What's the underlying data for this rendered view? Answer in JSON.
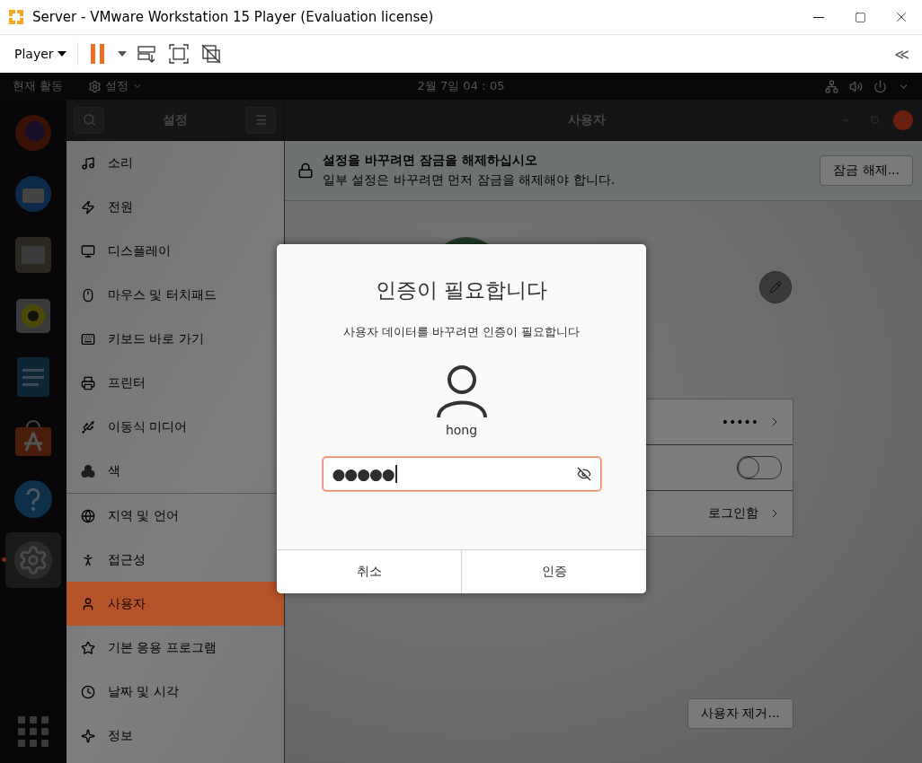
{
  "window": {
    "title": "Server - VMware Workstation 15 Player (Evaluation license)"
  },
  "toolbar": {
    "player_menu": "Player",
    "collapse": "≪"
  },
  "top_bar": {
    "activities": "현재 활동",
    "app_menu": "설정",
    "clock": "2월 7일  04：05"
  },
  "dock_items": [
    {
      "running": false
    },
    {
      "running": false
    },
    {
      "running": false
    },
    {
      "running": false
    },
    {
      "running": false
    },
    {
      "running": false
    },
    {
      "running": false
    },
    {
      "running": true
    }
  ],
  "settings_header": {
    "sidebar_title": "설정",
    "page_title": "사용자"
  },
  "sidebar": {
    "items": [
      {
        "label": "소리",
        "selected": false,
        "separator_after": false
      },
      {
        "label": "전원",
        "selected": false,
        "separator_after": false
      },
      {
        "label": "디스플레이",
        "selected": false,
        "separator_after": false
      },
      {
        "label": "마우스 및 터치패드",
        "selected": false,
        "separator_after": false
      },
      {
        "label": "키보드 바로 가기",
        "selected": false,
        "separator_after": false
      },
      {
        "label": "프린터",
        "selected": false,
        "separator_after": false
      },
      {
        "label": "이동식 미디어",
        "selected": false,
        "separator_after": false
      },
      {
        "label": "색",
        "selected": false,
        "separator_after": true
      },
      {
        "label": "지역 및 언어",
        "selected": false,
        "separator_after": false
      },
      {
        "label": "접근성",
        "selected": false,
        "separator_after": false
      },
      {
        "label": "사용자",
        "selected": true,
        "separator_after": false
      },
      {
        "label": "기본 응용 프로그램",
        "selected": false,
        "separator_after": false
      },
      {
        "label": "날짜 및 시각",
        "selected": false,
        "separator_after": false
      },
      {
        "label": "정보",
        "selected": false,
        "separator_after": false
      }
    ]
  },
  "lock_banner": {
    "title": "설정을 바꾸려면 잠금을 해제하십시오",
    "subtitle": "일부 설정은 바꾸려면 먼저 잠금을 해제해야 합니다.",
    "button": "잠금 해제..."
  },
  "user_rows": [
    {
      "kind": "value",
      "value": "•••••"
    },
    {
      "kind": "toggle",
      "on": false
    },
    {
      "kind": "value",
      "value": "로그인함"
    }
  ],
  "remove_button": "사용자 제거...",
  "dialog": {
    "title": "인증이 필요합니다",
    "message": "사용자 데이터를 바꾸려면 인증이 필요합니다",
    "user": "hong",
    "password": "●●●●●",
    "buttons": [
      "취소",
      "인증"
    ]
  }
}
